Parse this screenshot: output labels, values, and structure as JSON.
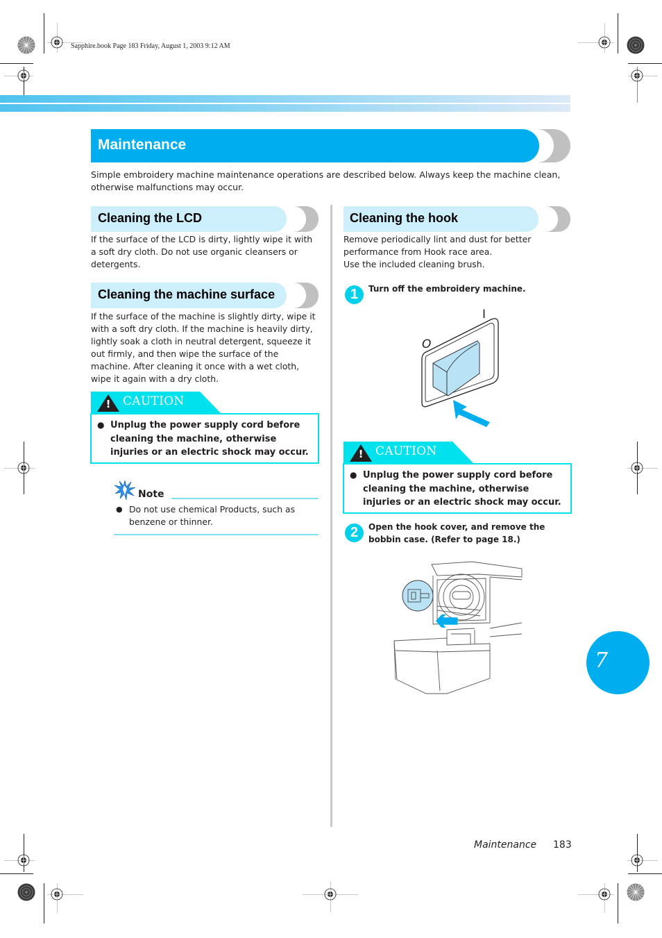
{
  "print_header": {
    "stamp": "Sapphire.book  Page 183  Friday, August 1, 2003  9:12 AM"
  },
  "page": {
    "title": "Maintenance",
    "intro": "Simple embroidery machine maintenance operations are described below. Always keep the machine clean, otherwise malfunctions may occur.",
    "accent_color": "#00aeef",
    "caution_color": "#00e1ee",
    "section_bg_color": "#cdeefb"
  },
  "left_column": {
    "lcd": {
      "heading": "Cleaning the LCD",
      "body": "If the surface of the LCD is dirty, lightly wipe it with a soft dry cloth. Do not use organic cleansers or detergents."
    },
    "surface": {
      "heading": "Cleaning the machine surface",
      "body": "If the surface of the machine is slightly dirty, wipe it with a soft dry cloth. If the machine is heavily dirty, lightly soak a cloth in neutral detergent, squeeze it out firmly, and then wipe the surface of the machine. After cleaning it once with a wet cloth, wipe it again with a dry cloth."
    },
    "caution": {
      "label": "CAUTION",
      "icon": "warning-triangle-icon",
      "text": "Unplug the power supply cord before cleaning the machine, otherwise injuries or an electric shock may occur."
    },
    "note": {
      "label": "Note",
      "icon": "note-sparkle-icon",
      "text": "Do not use chemical Products, such as benzene or thinner."
    }
  },
  "right_column": {
    "hook": {
      "heading": "Cleaning the hook",
      "body_lines": [
        "Remove periodically lint and dust for better",
        "performance from Hook race area.",
        "Use the included cleaning brush."
      ]
    },
    "steps": [
      {
        "number": "1",
        "text": "Turn off the embroidery machine."
      },
      {
        "number": "2",
        "text": "Open the hook cover, and remove the bobbin case. (Refer to page 18.)"
      }
    ],
    "switch_figure": {
      "on_label": "I",
      "off_label": "O"
    },
    "caution": {
      "label": "CAUTION",
      "icon": "warning-triangle-icon",
      "text": "Unplug the power supply cord before cleaning the machine, otherwise injuries or an electric shock may occur."
    }
  },
  "chapter_tab": {
    "number": "7"
  },
  "footer": {
    "section": "Maintenance",
    "page_number": "183"
  },
  "bullet_glyph": "●",
  "exclamation": "!"
}
